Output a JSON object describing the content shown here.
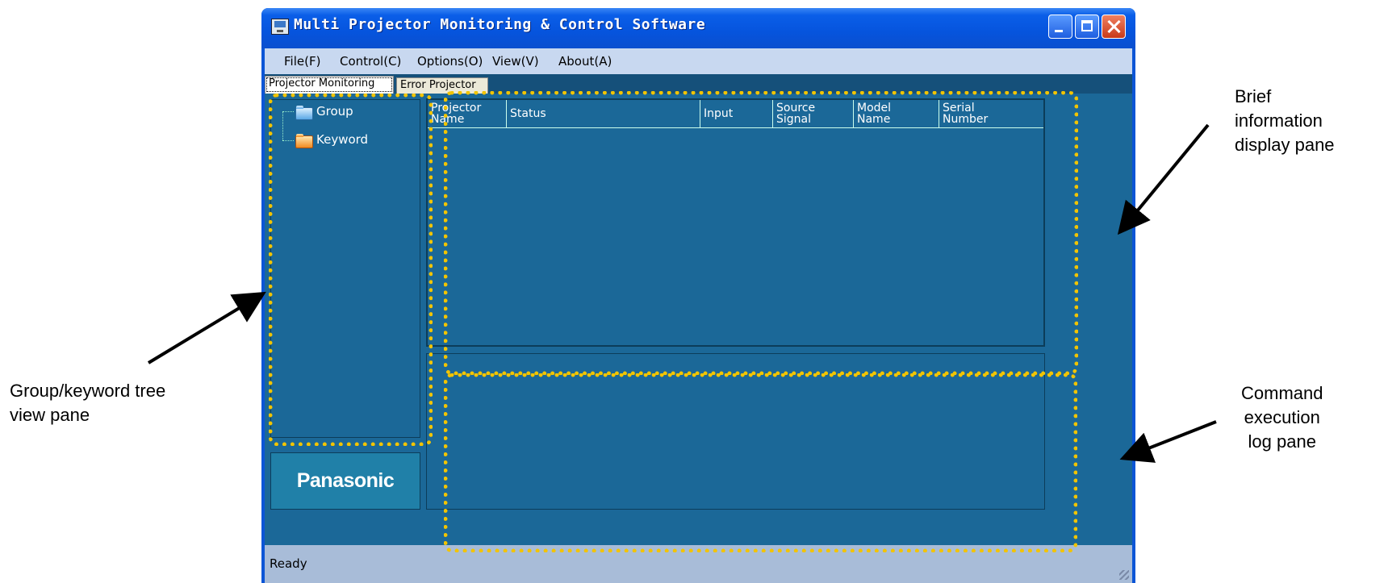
{
  "window": {
    "title": "Multi Projector Monitoring & Control Software"
  },
  "menu": [
    "File(F)",
    "Control(C)",
    "Options(O)",
    "View(V)",
    "About(A)"
  ],
  "tabs": [
    "Projector Monitoring",
    "Error Projector"
  ],
  "tree": [
    "Group",
    "Keyword"
  ],
  "table": {
    "columns": [
      [
        "Projector",
        "Name"
      ],
      [
        "Status"
      ],
      [
        "Input"
      ],
      [
        "Source",
        "Signal"
      ],
      [
        "Model",
        "Name"
      ],
      [
        "Serial",
        "Number"
      ]
    ]
  },
  "logo": "Panasonic",
  "status": "Ready",
  "callouts": {
    "brief": [
      "Brief",
      "information",
      "display pane"
    ],
    "tree": [
      "Group/keyword tree",
      "view pane"
    ],
    "log": [
      "Command",
      "execution",
      "log pane"
    ]
  },
  "colors": {
    "highlight": "#f2c400",
    "pane": "#1b6898",
    "titlebar": "#0654dd"
  }
}
